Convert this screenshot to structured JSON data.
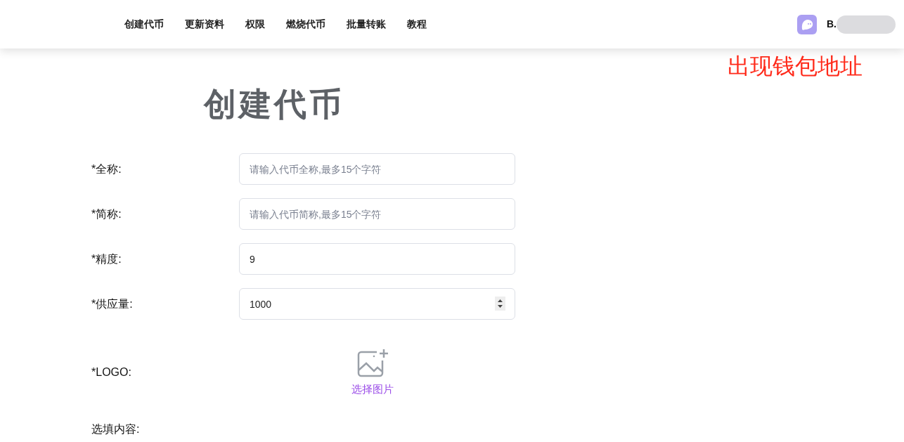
{
  "nav": {
    "items": [
      {
        "label": "创建代币"
      },
      {
        "label": "更新资料"
      },
      {
        "label": "权限"
      },
      {
        "label": "燃烧代币"
      },
      {
        "label": "批量转账"
      },
      {
        "label": "教程"
      }
    ],
    "wallet": {
      "address": "B."
    }
  },
  "annotation": "出现钱包地址",
  "form": {
    "title": "创建代币",
    "fields": [
      {
        "label": "*全称:",
        "kind": "text",
        "placeholder": "请输入代币全称,最多15个字符"
      },
      {
        "label": "*简称:",
        "kind": "text",
        "placeholder": "请输入代币简称,最多15个字符"
      },
      {
        "label": "*精度:",
        "kind": "text",
        "value": "9"
      },
      {
        "label": "*供应量:",
        "kind": "number",
        "value": "1000"
      }
    ],
    "logo": {
      "label": "*LOGO:",
      "button": "选择图片"
    },
    "optional": {
      "label": "选填内容:"
    }
  }
}
